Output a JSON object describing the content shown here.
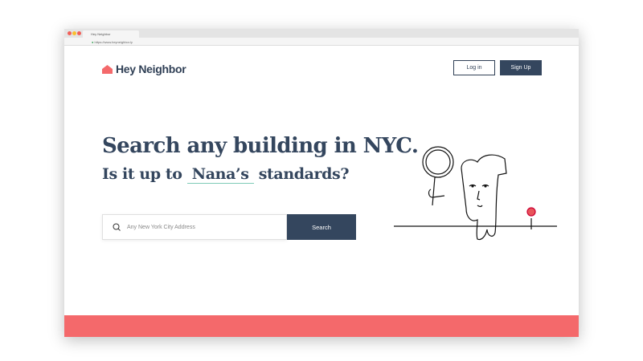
{
  "browser": {
    "tab_title": "Hey Neighbor",
    "url": "https://www.heyneighbor.ly"
  },
  "header": {
    "logo": "Hey Neighbor",
    "login": "Log in",
    "signup": "Sign Up"
  },
  "hero": {
    "title": "Search any building in NYC.",
    "subtitle_pre": "Is it up to",
    "subtitle_name": "Nana’s",
    "subtitle_post": "standards?"
  },
  "search": {
    "placeholder": "Any New York City Address",
    "button": "Search"
  },
  "colors": {
    "brand": "#34465e",
    "accent": "#f4696b"
  }
}
